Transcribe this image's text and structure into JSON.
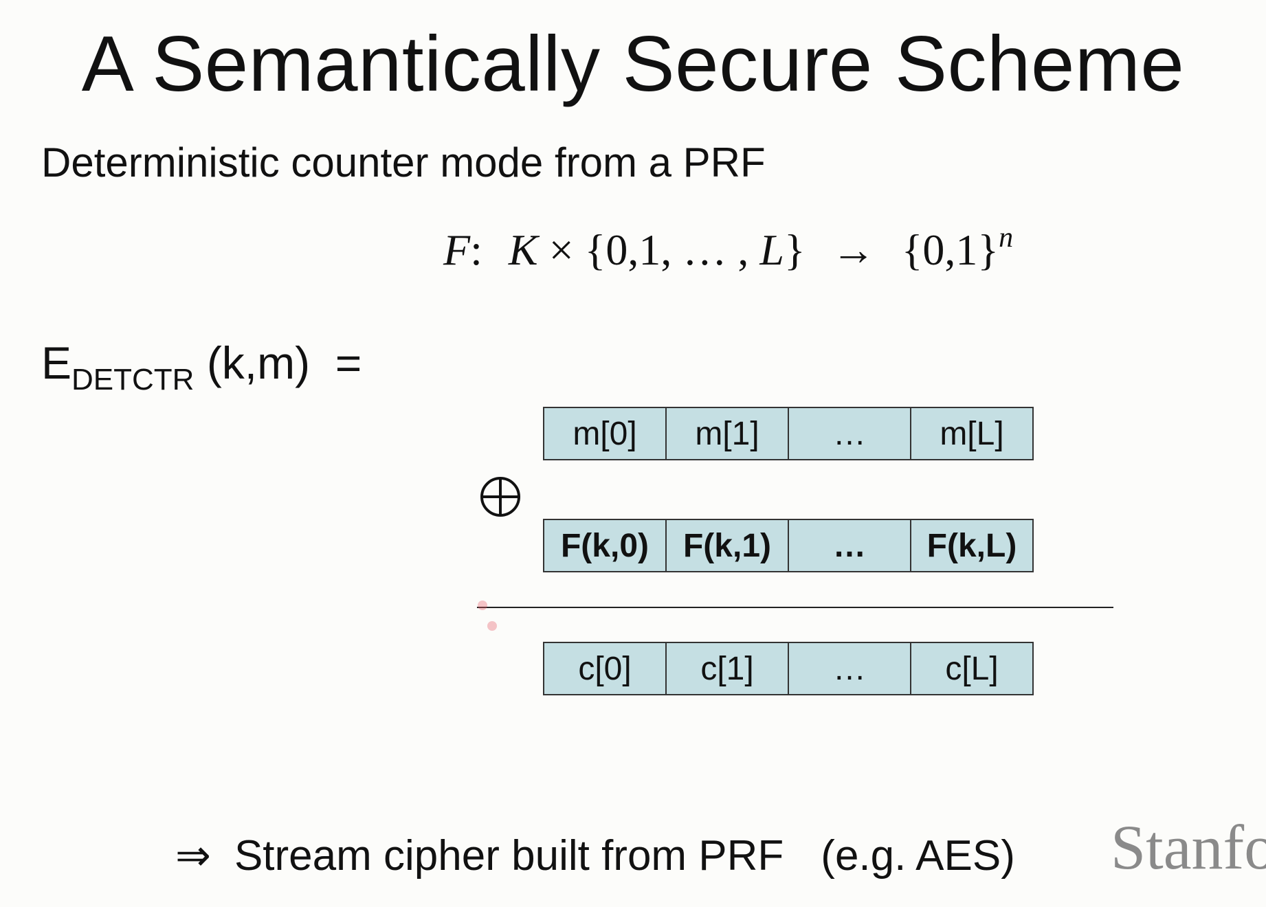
{
  "title": "A Semantically Secure Scheme",
  "subtitle": "Deterministic counter mode from a PRF",
  "formula": {
    "f": "F",
    "colon": ":",
    "k": "K",
    "times": "×",
    "domain_open": "{0,1, … , ",
    "domain_l": "L",
    "domain_close": "}",
    "arrow": "→",
    "range": "{0,1}",
    "exp": "n"
  },
  "encryption": {
    "e": "E",
    "subscript": "DETCTR",
    "args": "(k,m)",
    "equals": "="
  },
  "message_blocks": [
    "m[0]",
    "m[1]",
    "…",
    "m[L]"
  ],
  "prf_blocks": [
    "F(k,0)",
    "F(k,1)",
    "…",
    "F(k,L)"
  ],
  "cipher_blocks": [
    "c[0]",
    "c[1]",
    "…",
    "c[L]"
  ],
  "xor_symbol": "⊕",
  "conclusion": {
    "arrow": "⇒",
    "text": "Stream cipher built from PRF",
    "example": "(e.g.  AES)"
  },
  "logo": "Stanfo",
  "colors": {
    "block_fill": "#c5dfe3",
    "block_border": "#333333",
    "background": "#fcfcfa",
    "logo": "#8a8a8a"
  }
}
